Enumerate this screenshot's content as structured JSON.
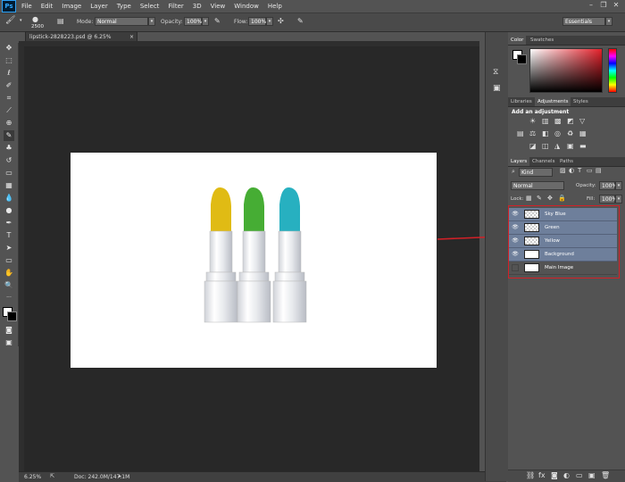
{
  "app": {
    "logo": "Ps"
  },
  "menu": [
    "File",
    "Edit",
    "Image",
    "Layer",
    "Type",
    "Select",
    "Filter",
    "3D",
    "View",
    "Window",
    "Help"
  ],
  "options": {
    "brush_size": "2500",
    "mode_label": "Mode:",
    "mode_value": "Normal",
    "opacity_label": "Opacity:",
    "opacity_value": "100%",
    "flow_label": "Flow:",
    "flow_value": "100%",
    "workspace": "Essentials"
  },
  "document": {
    "tab_title": "lipstick-2828223.psd @ 6.25% (RGB/8#)",
    "zoom": "6.25%",
    "doc_size": "Doc: 242.0M/147.1M"
  },
  "panels": {
    "color": {
      "tabs": [
        "Color",
        "Swatches"
      ]
    },
    "adjustments": {
      "tabs": [
        "Libraries",
        "Adjustments",
        "Styles"
      ],
      "heading": "Add an adjustment"
    },
    "layers": {
      "tabs": [
        "Layers",
        "Channels",
        "Paths"
      ],
      "filter_kind": "Kind",
      "blend_mode": "Normal",
      "opacity_label": "Opacity:",
      "opacity_value": "100%",
      "lock_label": "Lock:",
      "fill_label": "Fill:",
      "fill_value": "100%",
      "items": [
        {
          "name": "Sky Blue",
          "visible": true,
          "selected": true
        },
        {
          "name": "Green",
          "visible": true,
          "selected": true
        },
        {
          "name": "Yellow",
          "visible": true,
          "selected": true
        },
        {
          "name": "Background",
          "visible": true,
          "selected": true
        },
        {
          "name": "Main Image",
          "visible": false,
          "selected": false
        }
      ]
    }
  },
  "colors": {
    "highlight": "#d32027",
    "layer_selected": "#6e7f9b",
    "lipstick_yellow": "#e5c21a",
    "lipstick_green": "#4cb33a",
    "lipstick_blue": "#2ab3c3"
  }
}
